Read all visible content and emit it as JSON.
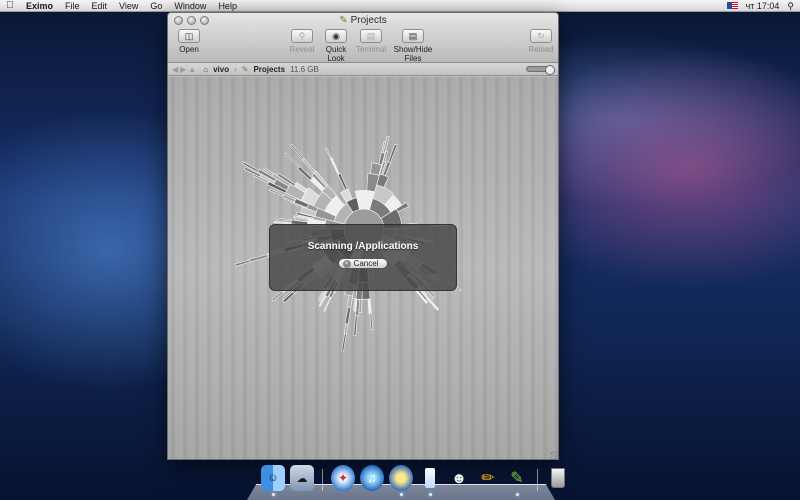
{
  "menubar": {
    "app_name": "Eximo",
    "menus": [
      "File",
      "Edit",
      "View",
      "Go",
      "Window",
      "Help"
    ],
    "clock": "чт 17:04"
  },
  "window": {
    "title": "Projects",
    "toolbar": {
      "open_label": "Open",
      "reveal_label": "Reveal",
      "quicklook_label": "Quick Look",
      "terminal_label": "Terminal",
      "showhide_label": "Show/Hide Files",
      "reload_label": "Reload"
    },
    "path": {
      "root": "vivo",
      "folder": "Projects",
      "size": "11.6 GB"
    },
    "scan": {
      "message": "Scanning /Applications",
      "cancel_label": "Cancel"
    }
  },
  "dock": {
    "items": [
      "finder-icon",
      "preview-icon",
      "safari-icon",
      "itunes-icon",
      "disk-icon",
      "milk-icon",
      "robot-icon",
      "pencil-icon",
      "green-brush-icon",
      "trash-icon"
    ]
  }
}
